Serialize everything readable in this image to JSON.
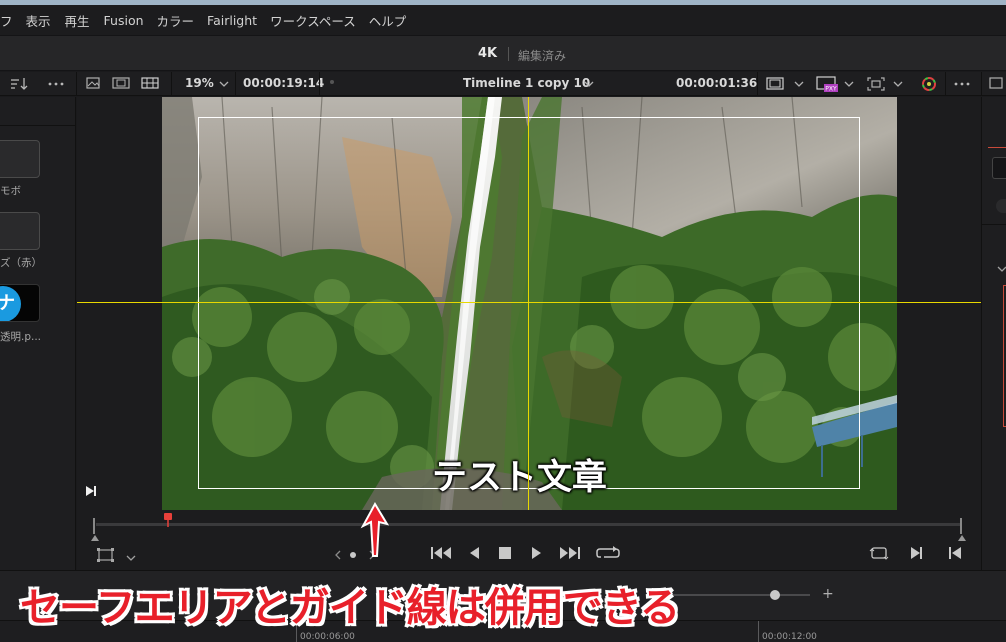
{
  "menu": {
    "items": [
      "フ",
      "表示",
      "再生",
      "Fusion",
      "カラー",
      "Fairlight",
      "ワークスペース",
      "ヘルプ"
    ]
  },
  "project": {
    "name": "4K",
    "status": "編集済み"
  },
  "viewer_toolbar": {
    "zoom": "19%",
    "source_timecode": "00:00:19:14",
    "timeline_name": "Timeline 1 copy 10",
    "record_timecode": "00:00:01:36"
  },
  "left_panel": {
    "clips": [
      {
        "label": "モボ"
      },
      {
        "label": "ズ（赤）"
      },
      {
        "label": "透明.p..."
      }
    ],
    "clip_badge": "ナ"
  },
  "viewer": {
    "overlay_text": "テスト文章",
    "safe_area_visible": true,
    "guide_color": "#e8d800"
  },
  "timeline_ruler": {
    "tc_1": "00:00:06:00",
    "tc_2": "00:00:12:00"
  },
  "annotation": {
    "caption": "セーフエリアとガイド線は併用できる",
    "color": "#e8202a"
  },
  "icons": [
    "sort-icon",
    "more-icon",
    "image-icon",
    "film-icon",
    "grid-icon",
    "chevron-down-icon",
    "loop-icon",
    "play-icon",
    "stop-icon",
    "skip-start-icon",
    "skip-end-icon",
    "step-back-icon",
    "fullscreen-icon",
    "color-wheel-icon"
  ]
}
